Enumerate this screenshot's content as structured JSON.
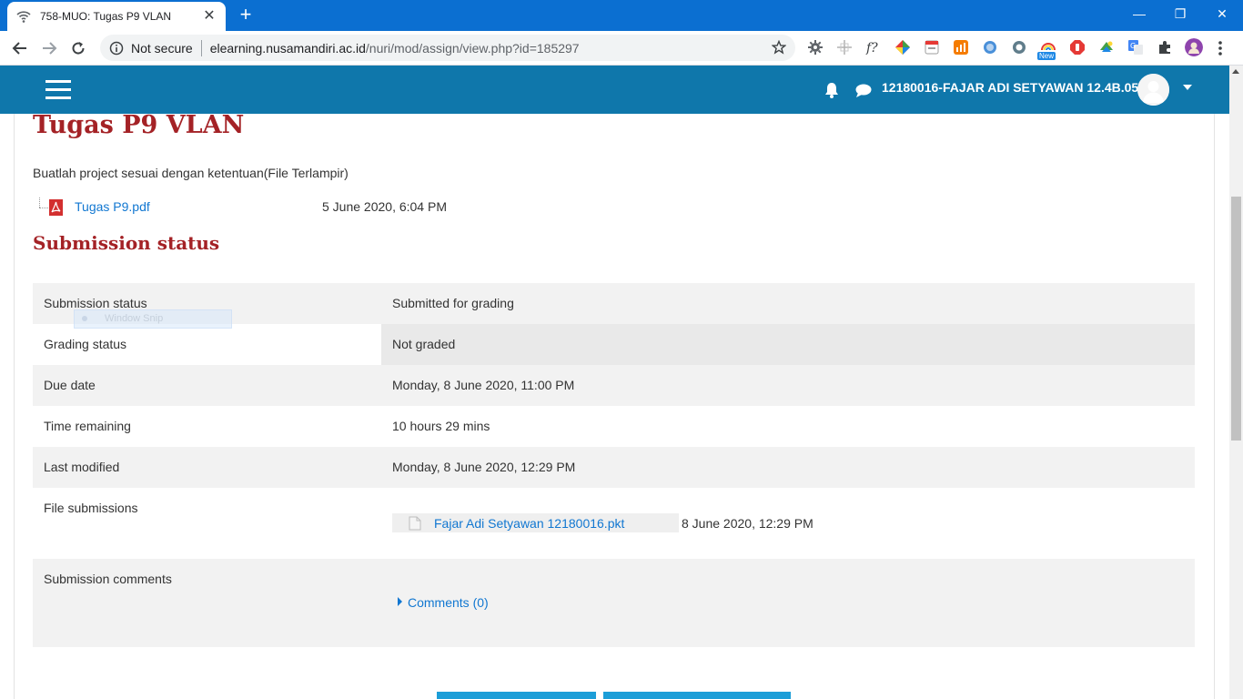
{
  "browser": {
    "tab_title": "758-MUO: Tugas P9 VLAN",
    "tab_close": "✕",
    "new_tab": "+",
    "window_controls": {
      "minimize": "—",
      "restore": "❐",
      "close": "✕"
    },
    "security_label": "Not secure",
    "url_host": "elearning.nusamandiri.ac.id",
    "url_path": "/nuri/mod/assign/view.php?id=185297",
    "extension_badge": "New",
    "extensions": [
      "gear-extension-icon",
      "move-extension-icon",
      "formula-extension-icon",
      "color-extension-icon",
      "calendar-extension-icon",
      "chart-extension-icon",
      "globe-extension-icon",
      "circle-extension-icon",
      "rainbow-extension-icon",
      "stop-hand-extension-icon",
      "google-earth-extension-icon",
      "translate-extension-icon",
      "puzzle-extension-icon",
      "profile-icon"
    ]
  },
  "navbar": {
    "username": "12180016-FAJAR ADI SETYAWAN 12.4B.05"
  },
  "assignment": {
    "title": "Tugas P9 VLAN",
    "intro": "Buatlah project sesuai dengan ketentuan(File Terlampir)",
    "attachment": {
      "name": "Tugas P9.pdf",
      "date": "5 June 2020, 6:04 PM"
    }
  },
  "submission": {
    "section_title": "Submission status",
    "rows": [
      {
        "label": "Submission status",
        "value": "Submitted for grading"
      },
      {
        "label": "Grading status",
        "value": "Not graded"
      },
      {
        "label": "Due date",
        "value": "Monday, 8 June 2020, 11:00 PM"
      },
      {
        "label": "Time remaining",
        "value": "10 hours 29 mins"
      },
      {
        "label": "Last modified",
        "value": "Monday, 8 June 2020, 12:29 PM"
      },
      {
        "label": "File submissions",
        "value": ""
      },
      {
        "label": "Submission comments",
        "value": ""
      }
    ],
    "file": {
      "name": "Fajar Adi Setyawan 12180016.pkt",
      "date": "8 June 2020, 12:29 PM"
    },
    "comments_link": "Comments (0)"
  },
  "overlay": {
    "snip_text": "Window Snip"
  },
  "colors": {
    "tabstrip": "#0b6fd1",
    "navbar": "#0f77ab",
    "heading": "#a42226",
    "link": "#1177d1",
    "button": "#1c9ed8"
  }
}
